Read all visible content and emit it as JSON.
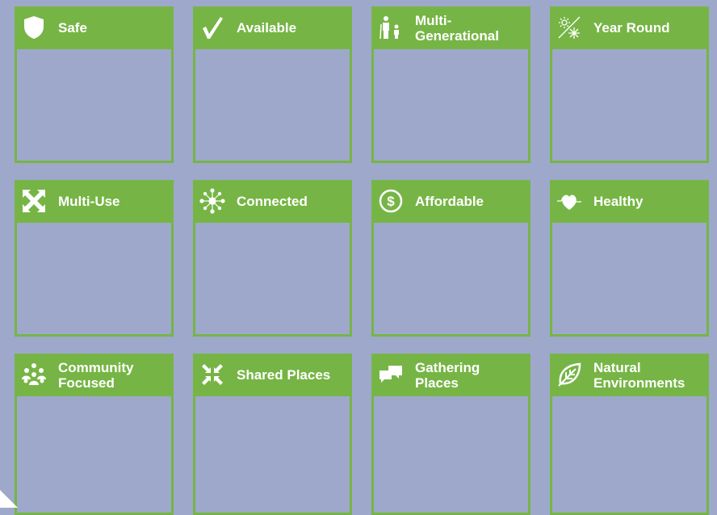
{
  "colors": {
    "background": "#9ea8cb",
    "accent": "#76b545",
    "text": "#ffffff"
  },
  "cards": [
    {
      "title": "Safe",
      "icon": "shield-icon"
    },
    {
      "title": "Available",
      "icon": "checkmark-icon"
    },
    {
      "title": "Multi-\nGenerational",
      "icon": "family-icon"
    },
    {
      "title": "Year Round",
      "icon": "sun-snowflake-icon"
    },
    {
      "title": "Multi-Use",
      "icon": "arrows-out-icon"
    },
    {
      "title": "Connected",
      "icon": "network-icon"
    },
    {
      "title": "Affordable",
      "icon": "dollar-icon"
    },
    {
      "title": "Healthy",
      "icon": "heart-pulse-icon"
    },
    {
      "title": "Community\nFocused",
      "icon": "community-icon"
    },
    {
      "title": "Shared Places",
      "icon": "arrows-in-icon"
    },
    {
      "title": "Gathering\nPlaces",
      "icon": "chat-bubbles-icon"
    },
    {
      "title": "Natural\nEnvironments",
      "icon": "leaf-icon"
    }
  ]
}
